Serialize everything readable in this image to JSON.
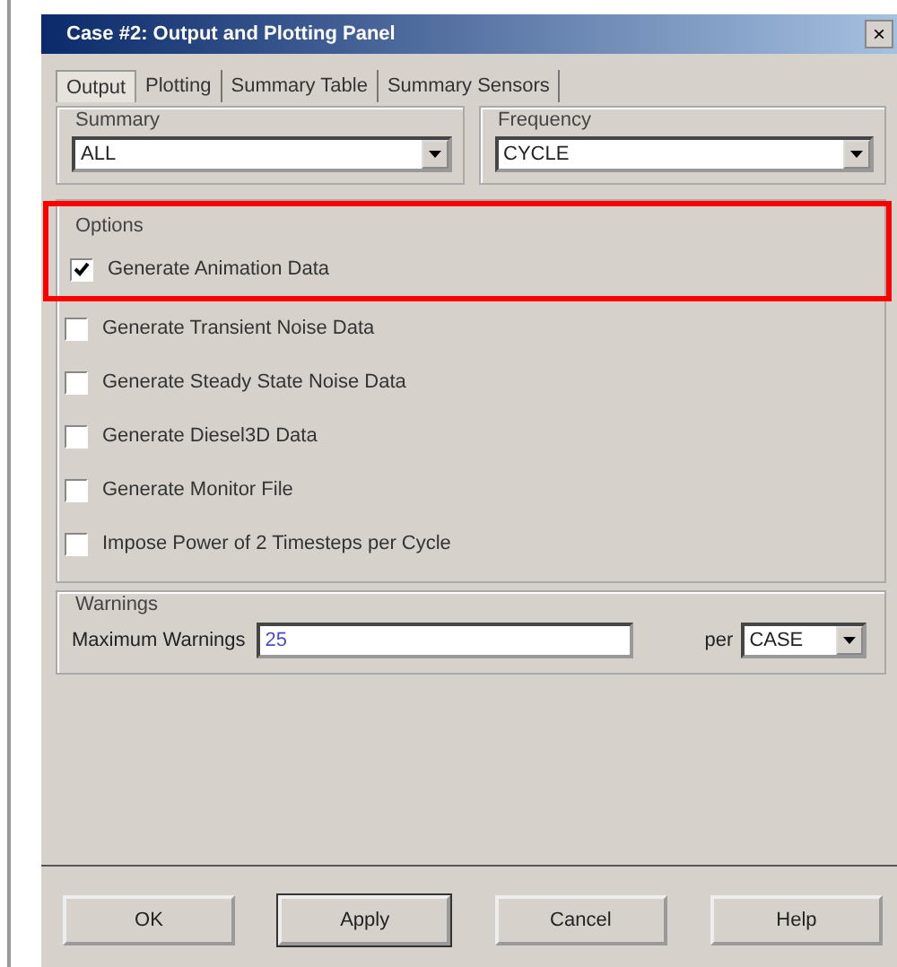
{
  "window": {
    "title": "Case #2: Output and Plotting Panel",
    "close": "×"
  },
  "tabs": [
    {
      "label": "Output",
      "selected": true
    },
    {
      "label": "Plotting",
      "selected": false
    },
    {
      "label": "Summary Table",
      "selected": false
    },
    {
      "label": "Summary Sensors",
      "selected": false
    }
  ],
  "dropdown_groups": [
    {
      "title": "Summary",
      "value": "ALL"
    },
    {
      "title": "Frequency",
      "value": "CYCLE"
    }
  ],
  "options": {
    "title": "Options",
    "items": [
      {
        "label": "Generate Animation Data",
        "checked": true,
        "highlighted": true
      },
      {
        "label": "Generate Transient Noise Data",
        "checked": false,
        "highlighted": false
      },
      {
        "label": "Generate Steady State Noise Data",
        "checked": false,
        "highlighted": false
      },
      {
        "label": "Generate Diesel3D Data",
        "checked": false,
        "highlighted": false
      },
      {
        "label": "Generate Monitor File",
        "checked": false,
        "highlighted": false
      },
      {
        "label": "Impose Power of 2 Timesteps per Cycle",
        "checked": false,
        "highlighted": false
      }
    ]
  },
  "warnings": {
    "title": "Warnings",
    "label": "Maximum Warnings",
    "value": "25",
    "per_label": "per",
    "per_value": "CASE"
  },
  "buttons": [
    {
      "label": "OK",
      "default": false
    },
    {
      "label": "Apply",
      "default": true
    },
    {
      "label": "Cancel",
      "default": false
    },
    {
      "label": "Help",
      "default": false
    }
  ]
}
